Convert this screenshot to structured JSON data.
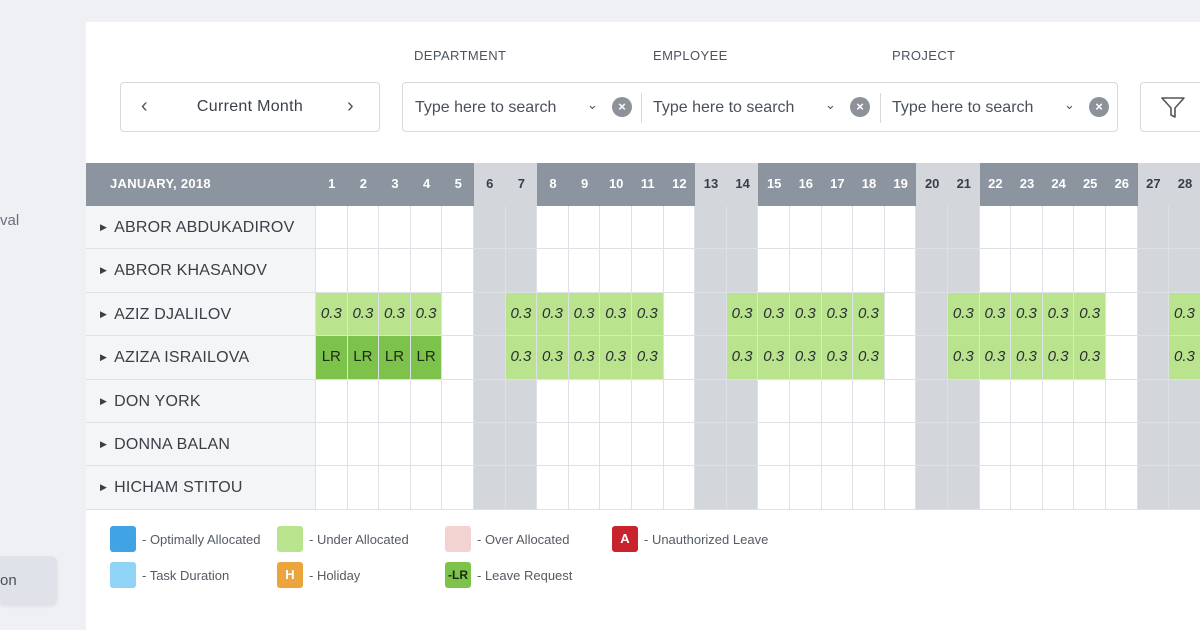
{
  "sidebar": {
    "text_1": "val",
    "button_label": "on"
  },
  "filters": {
    "department_label": "DEPARTMENT",
    "employee_label": "EMPLOYEE",
    "project_label": "PROJECT",
    "period": "Current Month",
    "search_placeholder": "Type here to search"
  },
  "grid": {
    "month_label": "JANUARY, 2018",
    "days": [
      1,
      2,
      3,
      4,
      5,
      6,
      7,
      8,
      9,
      10,
      11,
      12,
      13,
      14,
      15,
      16,
      17,
      18,
      19,
      20,
      21,
      22,
      23,
      24,
      25,
      26,
      27,
      28
    ],
    "weekend_days": [
      6,
      7,
      13,
      14,
      20,
      21,
      27,
      28
    ],
    "employees": [
      {
        "name": "ABROR ABDUKADIROV",
        "cells": []
      },
      {
        "name": "ABROR KHASANOV",
        "cells": []
      },
      {
        "name": "AZIZ DJALILOV",
        "cells": [
          "0.3",
          "0.3",
          "0.3",
          "0.3",
          "",
          "",
          "0.3",
          "0.3",
          "0.3",
          "0.3",
          "0.3",
          "",
          "",
          "0.3",
          "0.3",
          "0.3",
          "0.3",
          "0.3",
          "",
          "",
          "0.3",
          "0.3",
          "0.3",
          "0.3",
          "0.3",
          "",
          "",
          "0.3"
        ]
      },
      {
        "name": "AZIZA ISRAILOVA",
        "cells": [
          "LR",
          "LR",
          "LR",
          "LR",
          "",
          "",
          "0.3",
          "0.3",
          "0.3",
          "0.3",
          "0.3",
          "",
          "",
          "0.3",
          "0.3",
          "0.3",
          "0.3",
          "0.3",
          "",
          "",
          "0.3",
          "0.3",
          "0.3",
          "0.3",
          "0.3",
          "",
          "",
          "0.3"
        ]
      },
      {
        "name": "DON YORK",
        "cells": []
      },
      {
        "name": "DONNA BALAN",
        "cells": []
      },
      {
        "name": "HICHAM STITOU",
        "cells": []
      }
    ]
  },
  "legend": [
    {
      "swatch": "",
      "label": "- Optimally Allocated",
      "color": "#3fa3e6"
    },
    {
      "swatch": "",
      "label": "- Under Allocated",
      "color": "#b9e38c"
    },
    {
      "swatch": "",
      "label": "- Over Allocated",
      "color": "#f2d3d1"
    },
    {
      "swatch": "A",
      "label": "- Unauthorized Leave",
      "color": "#c8232c"
    },
    {
      "swatch": "",
      "label": "- Task Duration",
      "color": "#8fd3f7"
    },
    {
      "swatch": "H",
      "label": "- Holiday",
      "color": "#eca43c"
    },
    {
      "swatch": "-LR",
      "label": "- Leave Request",
      "color": "#7cc24b"
    }
  ]
}
